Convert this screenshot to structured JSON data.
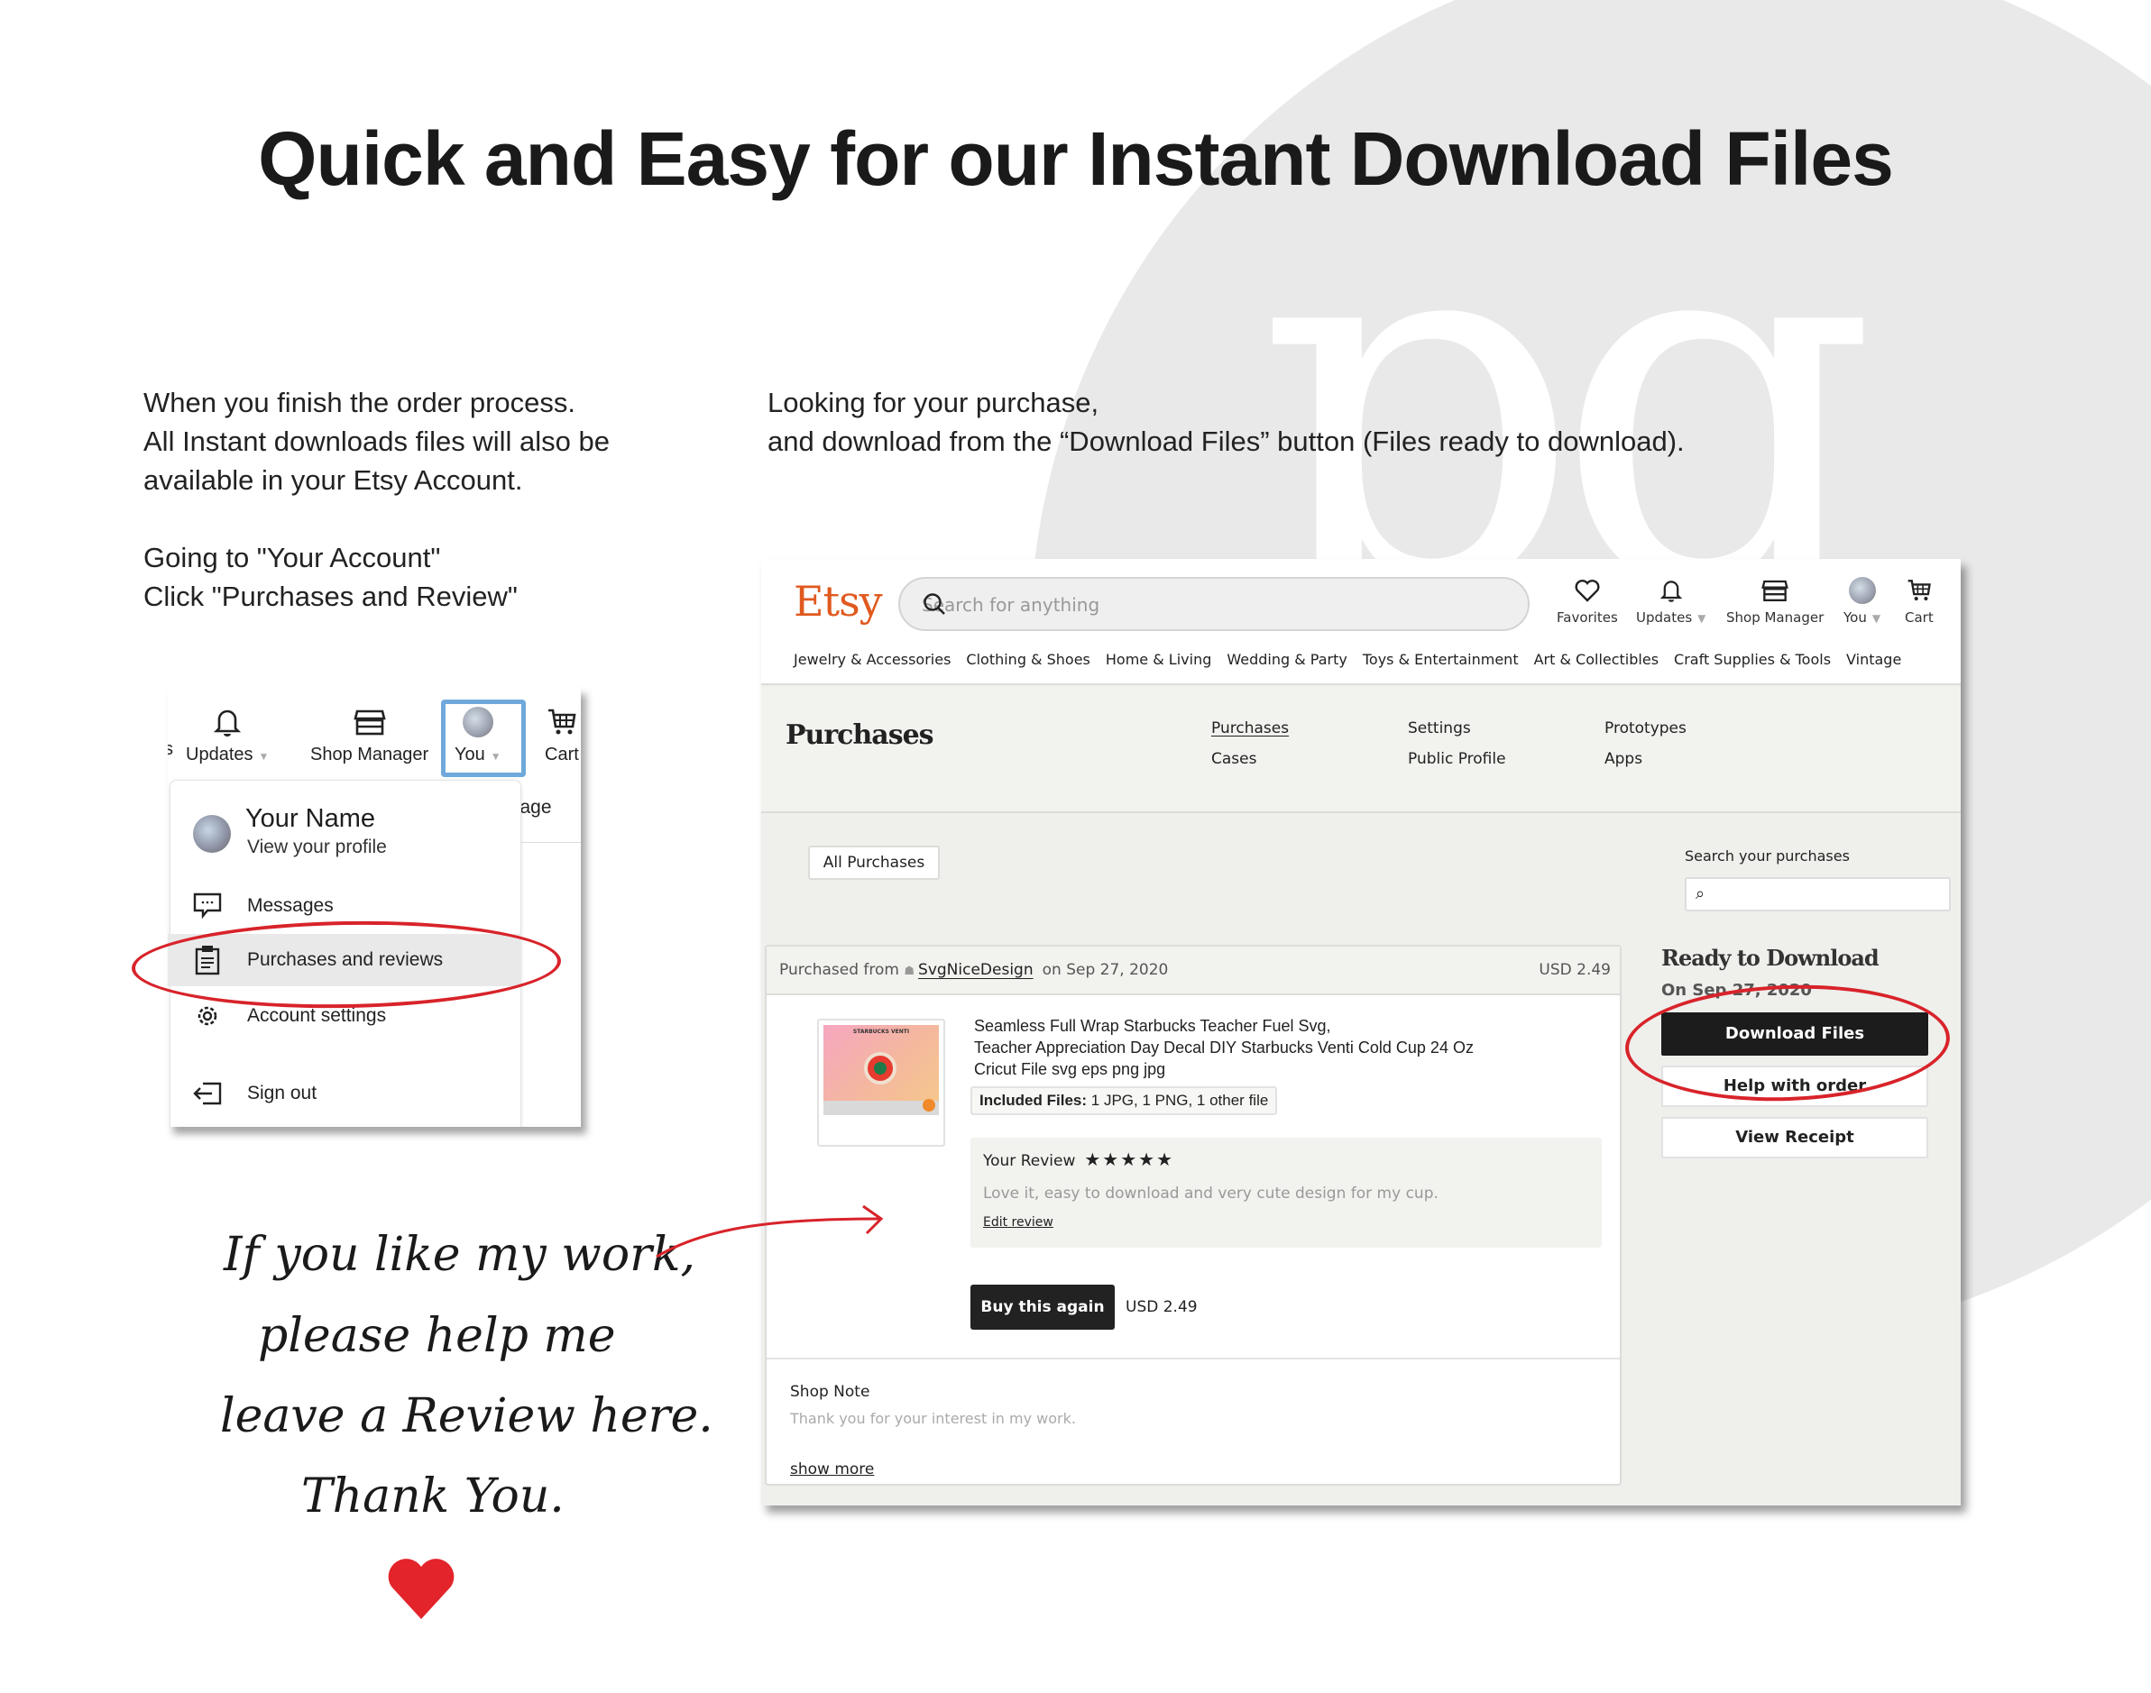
{
  "title": "Quick and Easy for our Instant Download Files",
  "monogram": "pg",
  "intro_left": {
    "para1": [
      "When you finish the order process.",
      "All Instant downloads files will also be",
      "available in your Etsy Account."
    ],
    "para2": [
      "Going to \"Your Account\"",
      "Click \"Purchases and Review\""
    ]
  },
  "intro_right": [
    "Looking for your purchase,",
    "and download from the “Download Files” button (Files ready to download)."
  ],
  "dropdown": {
    "nav": {
      "partial_left": "s",
      "updates": "Updates",
      "shop_manager": "Shop Manager",
      "you": "You",
      "cart": "Cart"
    },
    "behind_text": "itage",
    "profile_name": "Your Name",
    "profile_sub": "View your profile",
    "items": [
      {
        "label": "Messages",
        "icon": "message-icon"
      },
      {
        "label": "Purchases and reviews",
        "icon": "clipboard-icon",
        "highlighted": true
      },
      {
        "label": "Account settings",
        "icon": "gear-icon"
      },
      {
        "label": "Sign out",
        "icon": "sign-out-icon"
      }
    ]
  },
  "etsy": {
    "logo": "Etsy",
    "search_placeholder": "Search for anything",
    "nav": {
      "favorites": "Favorites",
      "updates": "Updates",
      "shop_manager": "Shop Manager",
      "you": "You",
      "cart": "Cart"
    },
    "categories": [
      "Jewelry & Accessories",
      "Clothing & Shoes",
      "Home & Living",
      "Wedding & Party",
      "Toys & Entertainment",
      "Art & Collectibles",
      "Craft Supplies & Tools",
      "Vintage"
    ],
    "page_title": "Purchases",
    "sublinks": [
      {
        "label": "Purchases",
        "active": true
      },
      {
        "label": "Cases"
      },
      {
        "label": "Settings"
      },
      {
        "label": "Public Profile"
      },
      {
        "label": "Prototypes"
      },
      {
        "label": "Apps"
      }
    ],
    "filter_button": "All Purchases",
    "search_label": "Search your purchases",
    "search_value": "",
    "order": {
      "purchased_from_label": "Purchased from",
      "shop_name": "SvgNiceDesign",
      "date_text": "on Sep 27, 2020",
      "price": "USD 2.49",
      "thumbnail_caption": "STARBUCKS VENTI",
      "item_title": [
        "Seamless Full Wrap Starbucks Teacher Fuel Svg,",
        "Teacher Appreciation Day Decal DIY Starbucks Venti Cold Cup 24 Oz",
        "Cricut File svg eps png jpg"
      ],
      "included_files_label": "Included Files:",
      "included_files_value": "1 JPG, 1 PNG, 1 other file",
      "review_label": "Your Review",
      "review_stars": 5,
      "review_stars_text": "★★★★★",
      "review_text": "Love it, easy to download and very cute design for my cup.",
      "edit_review": "Edit review",
      "buy_again": "Buy this again",
      "buy_price": "USD 2.49",
      "shop_note_title": "Shop Note",
      "shop_note_text": "Thank you for your interest in my work.",
      "show_more": "show more"
    },
    "side": {
      "ready_title": "Ready to Download",
      "ready_date": "On Sep 27, 2020",
      "download_button": "Download Files",
      "help_button": "Help with order",
      "receipt_button": "View Receipt"
    }
  },
  "handwritten": [
    "If you like my work,",
    "please help me",
    "leave a Review here.",
    "Thank You."
  ],
  "colors": {
    "etsy_orange": "#e0591f",
    "annotation_red": "#d8232a",
    "highlight_blue": "#6fa9db",
    "heart_red": "#e3242b"
  }
}
